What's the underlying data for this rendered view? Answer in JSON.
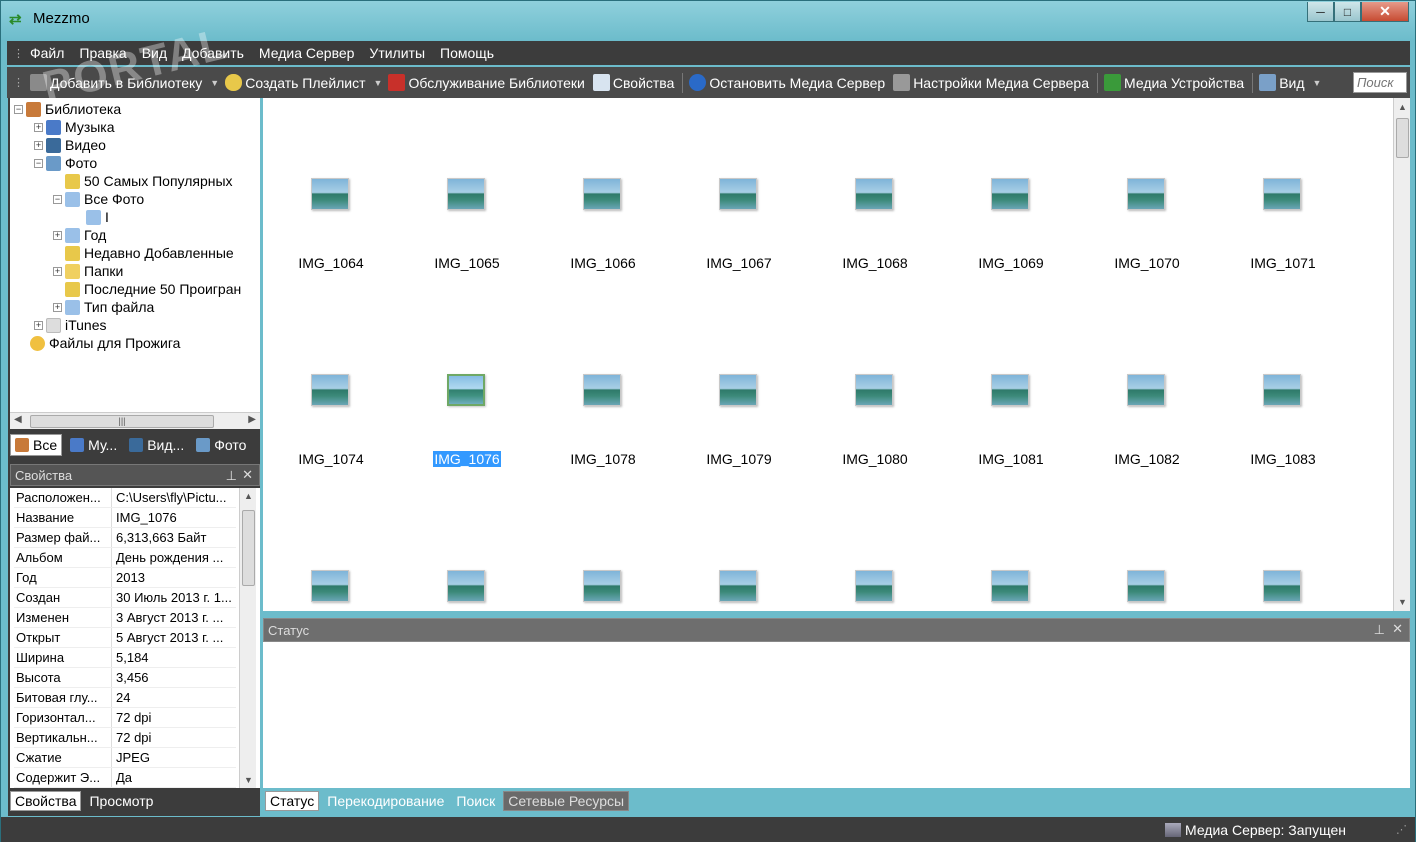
{
  "window": {
    "title": "Mezzmo",
    "minimize": "─",
    "maximize": "□",
    "close": "✕"
  },
  "menu": [
    "Файл",
    "Правка",
    "Вид",
    "Добавить",
    "Медиа Сервер",
    "Утилиты",
    "Помощь"
  ],
  "toolbar": {
    "add_library": "Добавить в Библиотеку",
    "create_playlist": "Создать Плейлист",
    "library_maintenance": "Обслуживание Библиотеки",
    "properties": "Свойства",
    "stop_server": "Остановить Медиа Сервер",
    "server_settings": "Настройки Медиа Сервера",
    "media_devices": "Медиа Устройства",
    "view": "Вид",
    "search_placeholder": "Поиск"
  },
  "watermark": "PORTAL",
  "tree": [
    {
      "label": "Библиотека",
      "icon": "home-icon",
      "exp": "−"
    },
    {
      "label": "Музыка",
      "icon": "music-icon",
      "exp": "+"
    },
    {
      "label": "Видео",
      "icon": "video-icon",
      "exp": "+"
    },
    {
      "label": "Фото",
      "icon": "photo-icon",
      "exp": "−"
    },
    {
      "label": "50 Самых Популярных",
      "icon": "bulb-icon",
      "exp": ""
    },
    {
      "label": "Все Фото",
      "icon": "folder-tree-icon",
      "exp": "−"
    },
    {
      "label": "I",
      "icon": "folder-tree-icon",
      "exp": ""
    },
    {
      "label": "Год",
      "icon": "folder-tree-icon",
      "exp": "+"
    },
    {
      "label": "Недавно Добавленные",
      "icon": "bulb-icon",
      "exp": ""
    },
    {
      "label": "Папки",
      "icon": "folder-icon",
      "exp": "+"
    },
    {
      "label": "Последние 50 Проигран",
      "icon": "bulb-icon",
      "exp": ""
    },
    {
      "label": "Тип файла",
      "icon": "folder-tree-icon",
      "exp": "+"
    },
    {
      "label": "iTunes",
      "icon": "itunes-icon",
      "exp": "+"
    },
    {
      "label": "Файлы для Прожига",
      "icon": "disc-icon",
      "exp": ""
    }
  ],
  "left_tabs": [
    "Все",
    "Му...",
    "Вид...",
    "Фото"
  ],
  "properties_panel": {
    "title": "Свойства",
    "rows": [
      {
        "key": "Расположен...",
        "value": "C:\\Users\\fly\\Pictu..."
      },
      {
        "key": "Название",
        "value": "IMG_1076"
      },
      {
        "key": "Размер фай...",
        "value": "6,313,663 Байт"
      },
      {
        "key": "Альбом",
        "value": "День рождения ..."
      },
      {
        "key": "Год",
        "value": "2013"
      },
      {
        "key": "Создан",
        "value": "30 Июль 2013 г. 1..."
      },
      {
        "key": "Изменен",
        "value": "3 Август 2013 г. ..."
      },
      {
        "key": "Открыт",
        "value": "5 Август 2013 г. ..."
      },
      {
        "key": "Ширина",
        "value": "5,184"
      },
      {
        "key": "Высота",
        "value": "3,456"
      },
      {
        "key": "Битовая глу...",
        "value": "24"
      },
      {
        "key": "Горизонтал...",
        "value": "72 dpi"
      },
      {
        "key": "Вертикальн...",
        "value": "72 dpi"
      },
      {
        "key": "Сжатие",
        "value": "JPEG"
      },
      {
        "key": "Содержит Э...",
        "value": "Да"
      }
    ]
  },
  "left_bottom_tabs": [
    "Свойства",
    "Просмотр"
  ],
  "thumbnails": [
    [
      "IMG_1064",
      "IMG_1065",
      "IMG_1066",
      "IMG_1067",
      "IMG_1068",
      "IMG_1069",
      "IMG_1070",
      "IMG_1071"
    ],
    [
      "IMG_1074",
      "IMG_1076",
      "IMG_1078",
      "IMG_1079",
      "IMG_1080",
      "IMG_1081",
      "IMG_1082",
      "IMG_1083"
    ],
    [
      "",
      "",
      "",
      "",
      "",
      "",
      "",
      ""
    ]
  ],
  "selected_thumbnail": "IMG_1076",
  "status_panel": {
    "title": "Статус"
  },
  "right_bottom_tabs": [
    "Статус",
    "Перекодирование",
    "Поиск",
    "Сетевые Ресурсы"
  ],
  "statusbar": {
    "server_status": "Медиа Сервер: Запущен"
  },
  "colors": {
    "dark_bar": "#3c3c3c",
    "selection": "#3399ff",
    "window_frame": "#6cbccb"
  }
}
